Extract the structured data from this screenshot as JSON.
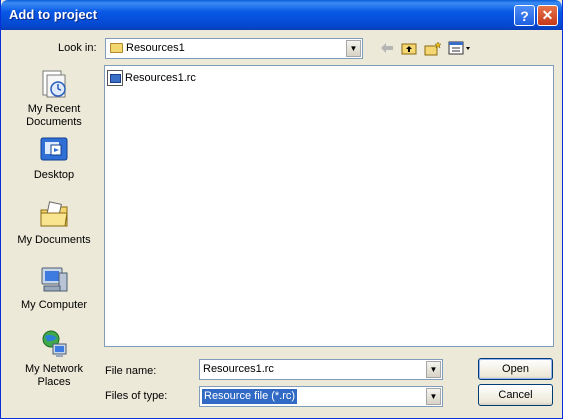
{
  "window": {
    "title": "Add to project"
  },
  "titlebar": {
    "help_label": "?",
    "close_label": "✕"
  },
  "look_in": {
    "label": "Look in:",
    "value": "Resources1"
  },
  "toolbar": {
    "back_icon": "back-arrow-icon",
    "up_icon": "up-folder-icon",
    "new_folder_icon": "new-folder-icon",
    "views_icon": "views-menu-icon"
  },
  "places": [
    {
      "label_line1": "My Recent",
      "label_line2": "Documents",
      "icon": "recent-documents-icon"
    },
    {
      "label_line1": "Desktop",
      "label_line2": "",
      "icon": "desktop-icon"
    },
    {
      "label_line1": "My Documents",
      "label_line2": "",
      "icon": "my-documents-icon"
    },
    {
      "label_line1": "My Computer",
      "label_line2": "",
      "icon": "my-computer-icon"
    },
    {
      "label_line1": "My Network",
      "label_line2": "Places",
      "icon": "network-places-icon"
    }
  ],
  "files": [
    {
      "name": "Resources1.rc",
      "icon": "resource-file-icon"
    }
  ],
  "file_name": {
    "label": "File name:",
    "value": "Resources1.rc"
  },
  "file_type": {
    "label": "Files of type:",
    "value": "Resource file (*.rc)"
  },
  "buttons": {
    "open": "Open",
    "cancel": "Cancel"
  },
  "colors": {
    "titlebar": "#0858e6",
    "dialog_bg": "#ece9d8",
    "selection": "#316ac5"
  }
}
